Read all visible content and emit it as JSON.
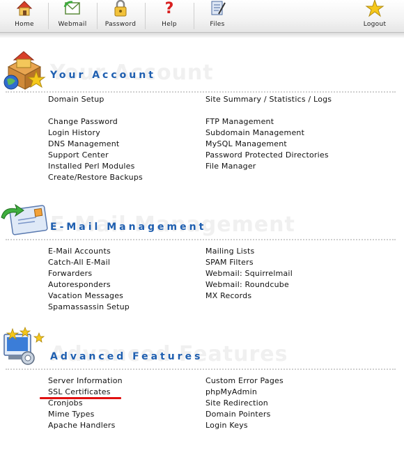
{
  "toolbar": {
    "items": [
      {
        "label": "Home",
        "icon": "home-icon"
      },
      {
        "label": "Webmail",
        "icon": "webmail-icon"
      },
      {
        "label": "Password",
        "icon": "lock-icon"
      },
      {
        "label": "Help",
        "icon": "question-icon"
      },
      {
        "label": "Files",
        "icon": "files-icon"
      },
      {
        "label": "Logout",
        "icon": "star-icon"
      }
    ]
  },
  "sections": {
    "account": {
      "title": "Your Account",
      "ghost": "Your Account",
      "left": [
        "Domain Setup",
        "Change Password",
        "Login History",
        "DNS Management",
        "Support Center",
        "Installed Perl Modules",
        "Create/Restore Backups"
      ],
      "right": [
        "Site Summary / Statistics / Logs",
        "FTP Management",
        "Subdomain Management",
        "MySQL Management",
        "Password Protected Directories",
        "File Manager"
      ]
    },
    "email": {
      "title": "E-Mail Management",
      "ghost": "E-Mail Management",
      "left": [
        "E-Mail Accounts",
        "Catch-All E-Mail",
        "Forwarders",
        "Autoresponders",
        "Vacation Messages",
        "Spamassassin Setup"
      ],
      "right": [
        "Mailing Lists",
        "SPAM Filters",
        "Webmail: Squirrelmail",
        "Webmail: Roundcube",
        "MX Records"
      ]
    },
    "advanced": {
      "title": "Advanced Features",
      "ghost": "Advanced Features",
      "left": [
        "Server Information",
        "SSL Certificates",
        "Cronjobs",
        "Mime Types",
        "Apache Handlers"
      ],
      "right": [
        "Custom Error Pages",
        "phpMyAdmin",
        "Site Redirection",
        "Domain Pointers",
        "Login Keys"
      ]
    }
  },
  "colors": {
    "title_blue": "#1f5fb0",
    "highlight_red": "#e01010"
  }
}
